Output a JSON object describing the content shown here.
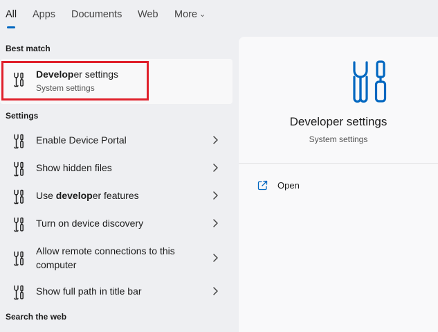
{
  "tabs": [
    {
      "label": "All"
    },
    {
      "label": "Apps"
    },
    {
      "label": "Documents"
    },
    {
      "label": "Web"
    },
    {
      "label": "More"
    }
  ],
  "sections": {
    "best_match": "Best match",
    "settings": "Settings",
    "search_web": "Search the web"
  },
  "best_match": {
    "title_bold": "Develop",
    "title_rest": "er settings",
    "subtitle": "System settings",
    "icon": "developer-tools-icon"
  },
  "settings_items": [
    {
      "pre": "Enable Device Portal",
      "bold": "",
      "post": ""
    },
    {
      "pre": "Show hidden files",
      "bold": "",
      "post": ""
    },
    {
      "pre": "Use ",
      "bold": "develop",
      "post": "er features"
    },
    {
      "pre": "Turn on device discovery",
      "bold": "",
      "post": ""
    },
    {
      "pre": "Allow remote connections to this",
      "bold": "",
      "post": "",
      "line2": "computer"
    },
    {
      "pre": "Show full path in title bar",
      "bold": "",
      "post": ""
    }
  ],
  "preview": {
    "title": "Developer settings",
    "subtitle": "System settings",
    "open_label": "Open"
  },
  "colors": {
    "accent": "#0067c0",
    "highlight": "#e0202b"
  }
}
